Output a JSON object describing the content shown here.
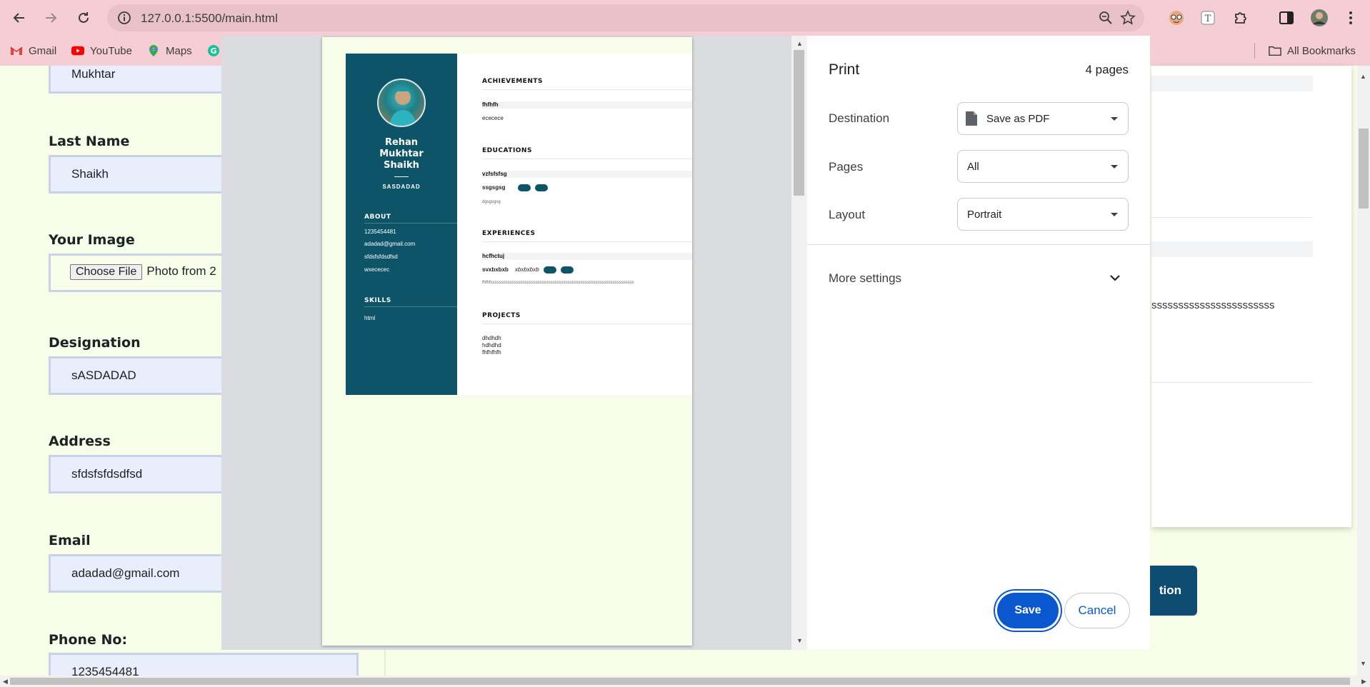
{
  "browser": {
    "url": "127.0.0.1:5500/main.html",
    "bookmarks": [
      "Gmail",
      "YouTube",
      "Maps"
    ],
    "all_bookmarks": "All Bookmarks"
  },
  "form": {
    "first_name_value": "Mukhtar",
    "last_name_label": "Last Name",
    "last_name_value": "Shaikh",
    "image_label": "Your Image",
    "choose_file": "Choose File",
    "file_name": "Photo from 2",
    "designation_label": "Designation",
    "designation_value": "sASDADAD",
    "address_label": "Address",
    "address_value": "sfdsfsfdsdfsd",
    "email_label": "Email",
    "email_value": "adadad@gmail.com",
    "phone_label": "Phone No:",
    "phone_value": "1235454481"
  },
  "background": {
    "sss_text": "sssssssssssssssssssssss",
    "button_fragment": "tion"
  },
  "print": {
    "title": "Print",
    "page_count": "4 pages",
    "destination_label": "Destination",
    "destination_value": "Save as PDF",
    "pages_label": "Pages",
    "pages_value": "All",
    "layout_label": "Layout",
    "layout_value": "Portrait",
    "more_settings": "More settings",
    "save": "Save",
    "cancel": "Cancel"
  },
  "resume": {
    "name_line1": "Rehan",
    "name_line2": "Mukhtar",
    "name_line3": "Shaikh",
    "designation": "SASDADAD",
    "about_heading": "ABOUT",
    "phone": "1235454481",
    "email": "adadad@gmail.com",
    "address": "sfdsfsfdsdfsd",
    "extra": "wxececec",
    "skills_heading": "SKILLS",
    "skill": "html",
    "achievements_heading": "ACHIEVEMENTS",
    "achievement_title": "fhfhfh",
    "achievement_desc": "ececece",
    "educations_heading": "EDUCATIONS",
    "edu_title": "vzfsfsfsg",
    "edu_sub": "ssgsgsg",
    "edu_desc": "dgsgsgsg",
    "experiences_heading": "EXPERIENCES",
    "exp_title": "hcfhctuj",
    "exp_sub": "svxbxbxb",
    "exp_sub_italic": "xbxbxbxb",
    "exp_desc": "fhfhfsssssssssssssssssssssssssssssssssssssssssssssssssssssssssssssssssss",
    "projects_heading": "PROJECTS",
    "proj1": "dhdhdh",
    "proj2": "hdhdhd",
    "proj3": "fhfhfhfh"
  }
}
